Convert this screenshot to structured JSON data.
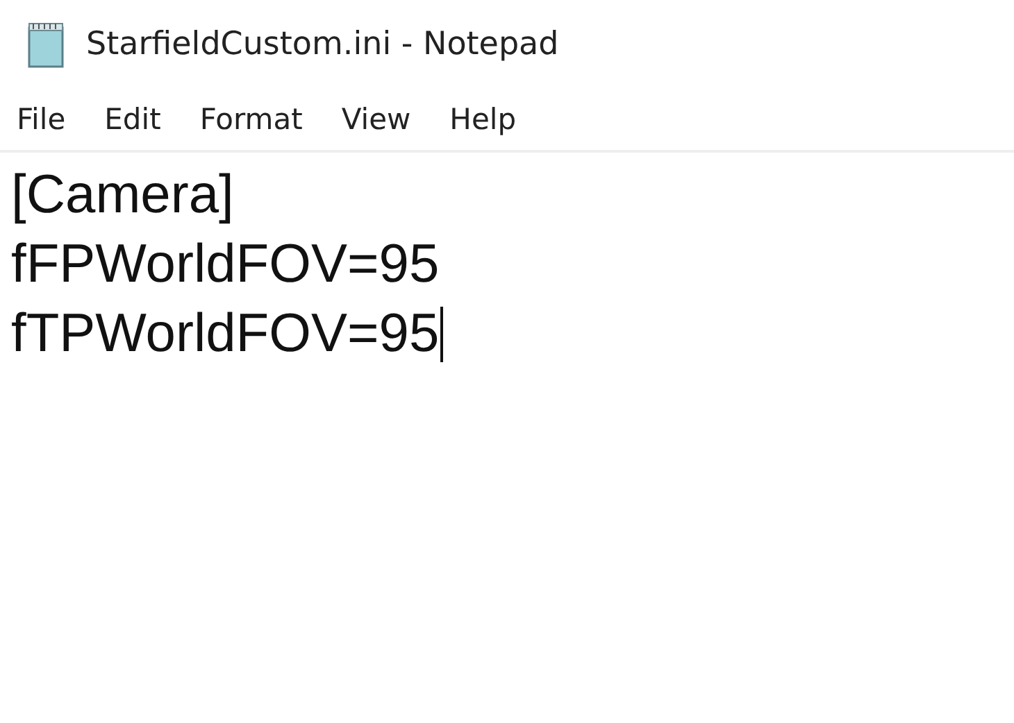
{
  "window": {
    "title": "StarfieldCustom.ini - Notepad"
  },
  "menu": [
    {
      "label": "File"
    },
    {
      "label": "Edit"
    },
    {
      "label": "Format"
    },
    {
      "label": "View"
    },
    {
      "label": "Help"
    }
  ],
  "editor": {
    "lines": [
      {
        "text": "[Camera]",
        "cursor": false
      },
      {
        "text": "fFPWorldFOV=95",
        "cursor": false
      },
      {
        "text": "fTPWorldFOV=95",
        "cursor": true
      }
    ]
  }
}
